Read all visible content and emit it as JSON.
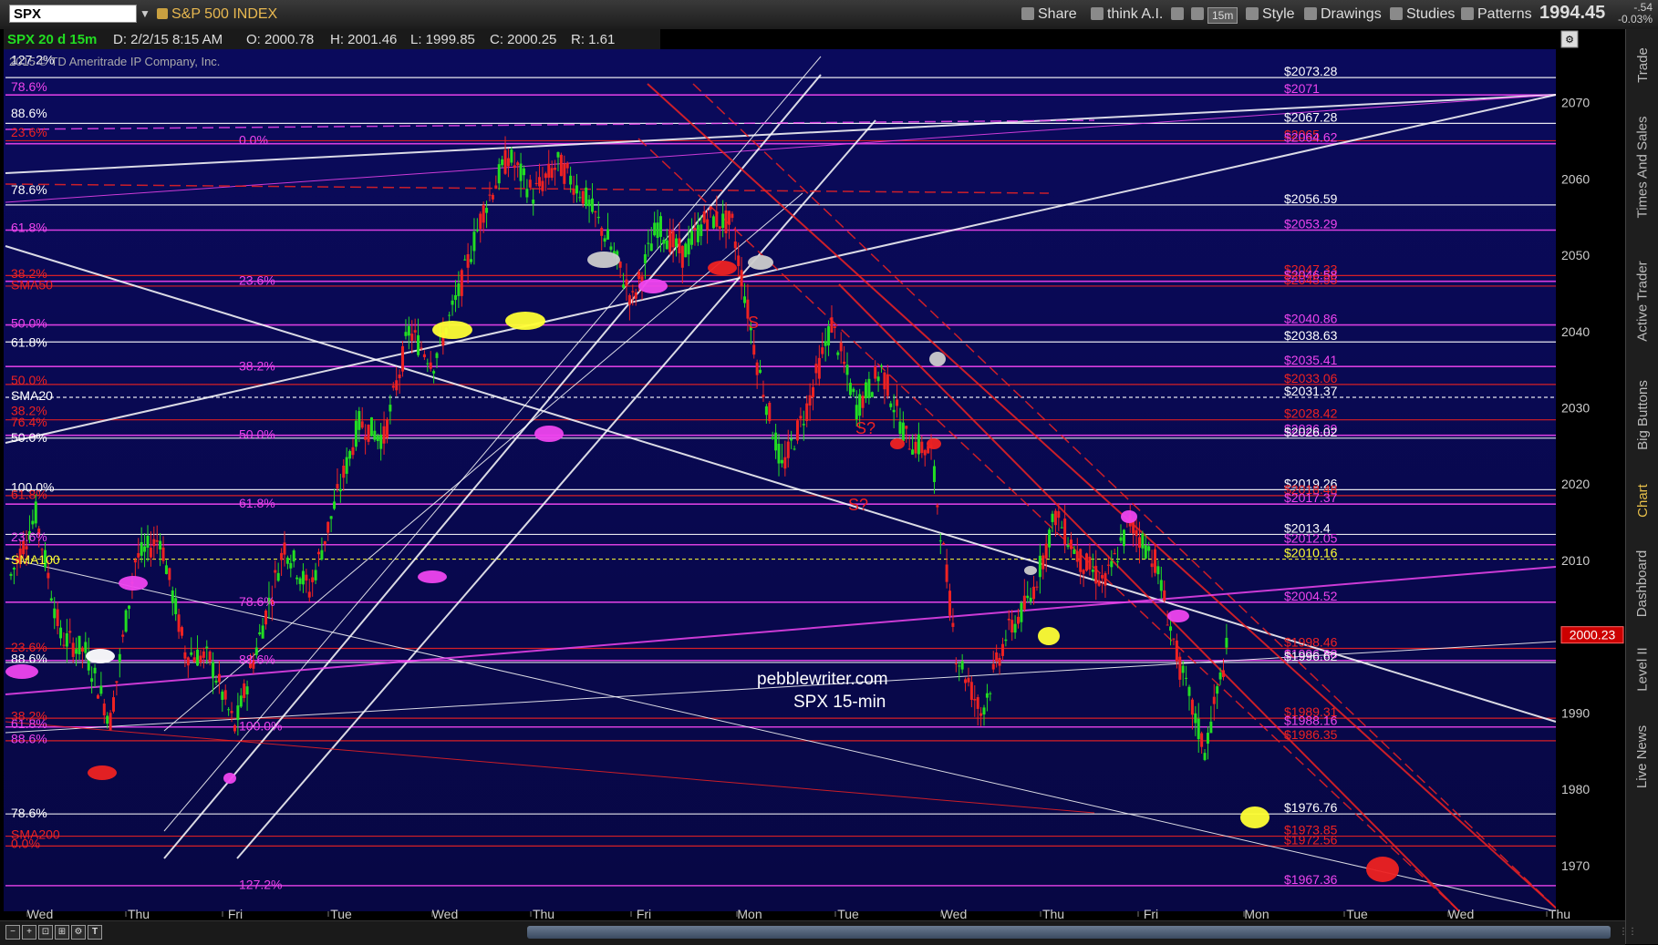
{
  "toolbar": {
    "symbol": "SPX",
    "index_name": "S&P 500 INDEX",
    "buttons": {
      "share": "Share",
      "think": "think A.I.",
      "interval": "15m",
      "style": "Style",
      "drawings": "Drawings",
      "studies": "Studies",
      "patterns": "Patterns"
    },
    "last": "1994.45",
    "net_change": "-.54",
    "pct_change": "-0.03%"
  },
  "header": {
    "spec": "SPX 20 d 15m",
    "date": "D: 2/2/15 8:15 AM",
    "open": "O: 2000.78",
    "high": "H: 2001.46",
    "low": "L: 1999.85",
    "close": "C: 2000.25",
    "range": "R: 1.61",
    "copyright": "2015 © TD Ameritrade IP Company, Inc."
  },
  "right_tabs": [
    "Trade",
    "Times And Sales",
    "Active Trader",
    "Big Buttons",
    "Chart",
    "Dashboard",
    "Level II",
    "Live News"
  ],
  "watermark": [
    "pebblewriter.com",
    "SPX 15-min"
  ],
  "colors": {
    "background": "#0a0a5a",
    "up": "#22cc22",
    "down": "#ee2222",
    "magenta": "#ee44ee",
    "white": "#ffffff",
    "red": "#dd1111",
    "price_box": "#cc0000"
  },
  "chart_data": {
    "type": "candlestick",
    "symbol": "SPX",
    "interval": "15m",
    "ylim": [
      1964,
      2077
    ],
    "yticks": [
      1970,
      1980,
      1990,
      2000,
      2010,
      2020,
      2030,
      2040,
      2050,
      2060,
      2070
    ],
    "x_labels": [
      "Wed",
      "Thu",
      "Fri",
      "Tue",
      "Wed",
      "Thu",
      "Fri",
      "Mon",
      "Tue",
      "Wed",
      "Thu",
      "Fri",
      "Mon",
      "Tue",
      "Wed",
      "Thu"
    ],
    "last_price": 2000.23,
    "close_path": [
      [
        0,
        2008
      ],
      [
        1,
        2016
      ],
      [
        2,
        2000
      ],
      [
        3,
        1998
      ],
      [
        4,
        1989
      ],
      [
        5,
        2010
      ],
      [
        6,
        2013
      ],
      [
        7,
        1998
      ],
      [
        8,
        1997
      ],
      [
        9,
        1988
      ],
      [
        10,
        2000
      ],
      [
        11,
        2012
      ],
      [
        12,
        2006
      ],
      [
        13,
        2017
      ],
      [
        14,
        2028
      ],
      [
        15,
        2026
      ],
      [
        16,
        2040
      ],
      [
        17,
        2036
      ],
      [
        18,
        2045
      ],
      [
        19,
        2056
      ],
      [
        20,
        2063
      ],
      [
        21,
        2058
      ],
      [
        22,
        2062
      ],
      [
        23,
        2058
      ],
      [
        24,
        2052
      ],
      [
        25,
        2044
      ],
      [
        26,
        2054
      ],
      [
        27,
        2050
      ],
      [
        28,
        2055
      ],
      [
        29,
        2054
      ],
      [
        30,
        2036
      ],
      [
        31,
        2022
      ],
      [
        32,
        2030
      ],
      [
        33,
        2041
      ],
      [
        34,
        2030
      ],
      [
        35,
        2035
      ],
      [
        36,
        2026
      ],
      [
        37,
        2024
      ],
      [
        38,
        1998
      ],
      [
        39,
        1990
      ],
      [
        40,
        2000
      ],
      [
        41,
        2005
      ],
      [
        42,
        2016
      ],
      [
        43,
        2010
      ],
      [
        44,
        2007
      ],
      [
        45,
        2015
      ],
      [
        46,
        2010
      ],
      [
        47,
        1996
      ],
      [
        48,
        1985
      ],
      [
        49,
        2000
      ]
    ],
    "levels": [
      {
        "price": 2073.28,
        "label": "$2073.28",
        "color": "white"
      },
      {
        "price": 2071,
        "label": "$2071",
        "color": "magenta"
      },
      {
        "price": 2067.28,
        "label": "$2067.28",
        "color": "white"
      },
      {
        "price": 2065,
        "label": "$2065",
        "color": "red"
      },
      {
        "price": 2064.62,
        "label": "$2064.62",
        "color": "magenta"
      },
      {
        "price": 2056.59,
        "label": "$2056.59",
        "color": "white"
      },
      {
        "price": 2053.29,
        "label": "$2053.29",
        "color": "magenta"
      },
      {
        "price": 2047.33,
        "label": "$2047.33",
        "color": "red"
      },
      {
        "price": 2046.58,
        "label": "$2046.58",
        "color": "magenta"
      },
      {
        "price": 2045.95,
        "label": "$2045.95",
        "color": "red"
      },
      {
        "price": 2040.86,
        "label": "$2040.86",
        "color": "magenta"
      },
      {
        "price": 2038.63,
        "label": "$2038.63",
        "color": "white"
      },
      {
        "price": 2035.41,
        "label": "$2035.41",
        "color": "magenta"
      },
      {
        "price": 2033.06,
        "label": "$2033.06",
        "color": "red"
      },
      {
        "price": 2031.37,
        "label": "$2031.37",
        "color": "white"
      },
      {
        "price": 2028.42,
        "label": "$2028.42",
        "color": "red"
      },
      {
        "price": 2026.39,
        "label": "$2026.39",
        "color": "magenta"
      },
      {
        "price": 2026.02,
        "label": "$2026.02",
        "color": "white"
      },
      {
        "price": 2019.26,
        "label": "$2019.26",
        "color": "white"
      },
      {
        "price": 2018.48,
        "label": "$2018.48",
        "color": "red"
      },
      {
        "price": 2017.37,
        "label": "$2017.37",
        "color": "magenta"
      },
      {
        "price": 2013.4,
        "label": "$2013.4",
        "color": "white"
      },
      {
        "price": 2012.05,
        "label": "$2012.05",
        "color": "magenta"
      },
      {
        "price": 2010.16,
        "label": "$2010.16",
        "color": "yellow"
      },
      {
        "price": 2004.52,
        "label": "$2004.52",
        "color": "magenta"
      },
      {
        "price": 1998.46,
        "label": "$1998.46",
        "color": "red"
      },
      {
        "price": 1996.88,
        "label": "$1996.88",
        "color": "magenta"
      },
      {
        "price": 1996.62,
        "label": "$1996.62",
        "color": "white"
      },
      {
        "price": 1989.31,
        "label": "$1989.31",
        "color": "red"
      },
      {
        "price": 1988.16,
        "label": "$1988.16",
        "color": "magenta"
      },
      {
        "price": 1986.35,
        "label": "$1986.35",
        "color": "red"
      },
      {
        "price": 1976.76,
        "label": "$1976.76",
        "color": "white"
      },
      {
        "price": 1973.85,
        "label": "$1973.85",
        "color": "red"
      },
      {
        "price": 1972.56,
        "label": "$1972.56",
        "color": "red"
      },
      {
        "price": 1967.36,
        "label": "$1967.36",
        "color": "magenta"
      }
    ],
    "left_labels": [
      {
        "price": 2075.5,
        "text": "127.2%",
        "color": "white"
      },
      {
        "price": 2072,
        "text": "78.6%",
        "color": "magenta"
      },
      {
        "price": 2068.5,
        "text": "88.6%",
        "color": "white"
      },
      {
        "price": 2066,
        "text": "23.6%",
        "color": "red"
      },
      {
        "price": 2058.5,
        "text": "78.6%",
        "color": "white"
      },
      {
        "price": 2053.5,
        "text": "61.8%",
        "color": "magenta"
      },
      {
        "price": 2047.5,
        "text": "38.2%",
        "color": "red"
      },
      {
        "price": 2046,
        "text": "SMA50",
        "color": "red"
      },
      {
        "price": 2041,
        "text": "50.0%",
        "color": "magenta"
      },
      {
        "price": 2038.5,
        "text": "61.8%",
        "color": "white"
      },
      {
        "price": 2033.5,
        "text": "50.0%",
        "color": "red"
      },
      {
        "price": 2031.5,
        "text": "SMA20",
        "color": "white"
      },
      {
        "price": 2029.5,
        "text": "38.2%",
        "color": "red"
      },
      {
        "price": 2028,
        "text": "76.4%",
        "color": "red"
      },
      {
        "price": 2026,
        "text": "50.0%",
        "color": "white"
      },
      {
        "price": 2019.5,
        "text": "100.0%",
        "color": "white"
      },
      {
        "price": 2018.5,
        "text": "61.8%",
        "color": "red"
      },
      {
        "price": 2013,
        "text": "23.6%",
        "color": "magenta"
      },
      {
        "price": 2010,
        "text": "SMA100",
        "color": "yellow"
      },
      {
        "price": 1998.5,
        "text": "23.6%",
        "color": "red"
      },
      {
        "price": 1997,
        "text": "88.6%",
        "color": "white"
      },
      {
        "price": 1989.5,
        "text": "38.2%",
        "color": "red"
      },
      {
        "price": 1988.5,
        "text": "61.8%",
        "color": "magenta"
      },
      {
        "price": 1986.5,
        "text": "88.6%",
        "color": "magenta"
      },
      {
        "price": 1976.8,
        "text": "78.6%",
        "color": "white"
      },
      {
        "price": 1974,
        "text": "SMA200",
        "color": "red"
      },
      {
        "price": 1972.8,
        "text": "0.0%",
        "color": "red"
      }
    ],
    "mid_labels": [
      {
        "price": 2065,
        "text": "0.0%",
        "color": "magenta"
      },
      {
        "price": 2046.6,
        "text": "23.6%",
        "color": "magenta"
      },
      {
        "price": 2035.4,
        "text": "38.2%",
        "color": "magenta"
      },
      {
        "price": 2026.4,
        "text": "50.0%",
        "color": "magenta"
      },
      {
        "price": 2017.4,
        "text": "61.8%",
        "color": "magenta"
      },
      {
        "price": 2004.5,
        "text": "78.6%",
        "color": "magenta"
      },
      {
        "price": 1996.9,
        "text": "88.6%",
        "color": "magenta"
      },
      {
        "price": 1988.2,
        "text": "100.0%",
        "color": "magenta"
      },
      {
        "price": 1967.4,
        "text": "127.2%",
        "color": "magenta"
      }
    ],
    "annotations": [
      {
        "text": "S",
        "color": "red"
      },
      {
        "text": "S?",
        "color": "red"
      },
      {
        "text": "S?",
        "color": "red"
      }
    ]
  }
}
